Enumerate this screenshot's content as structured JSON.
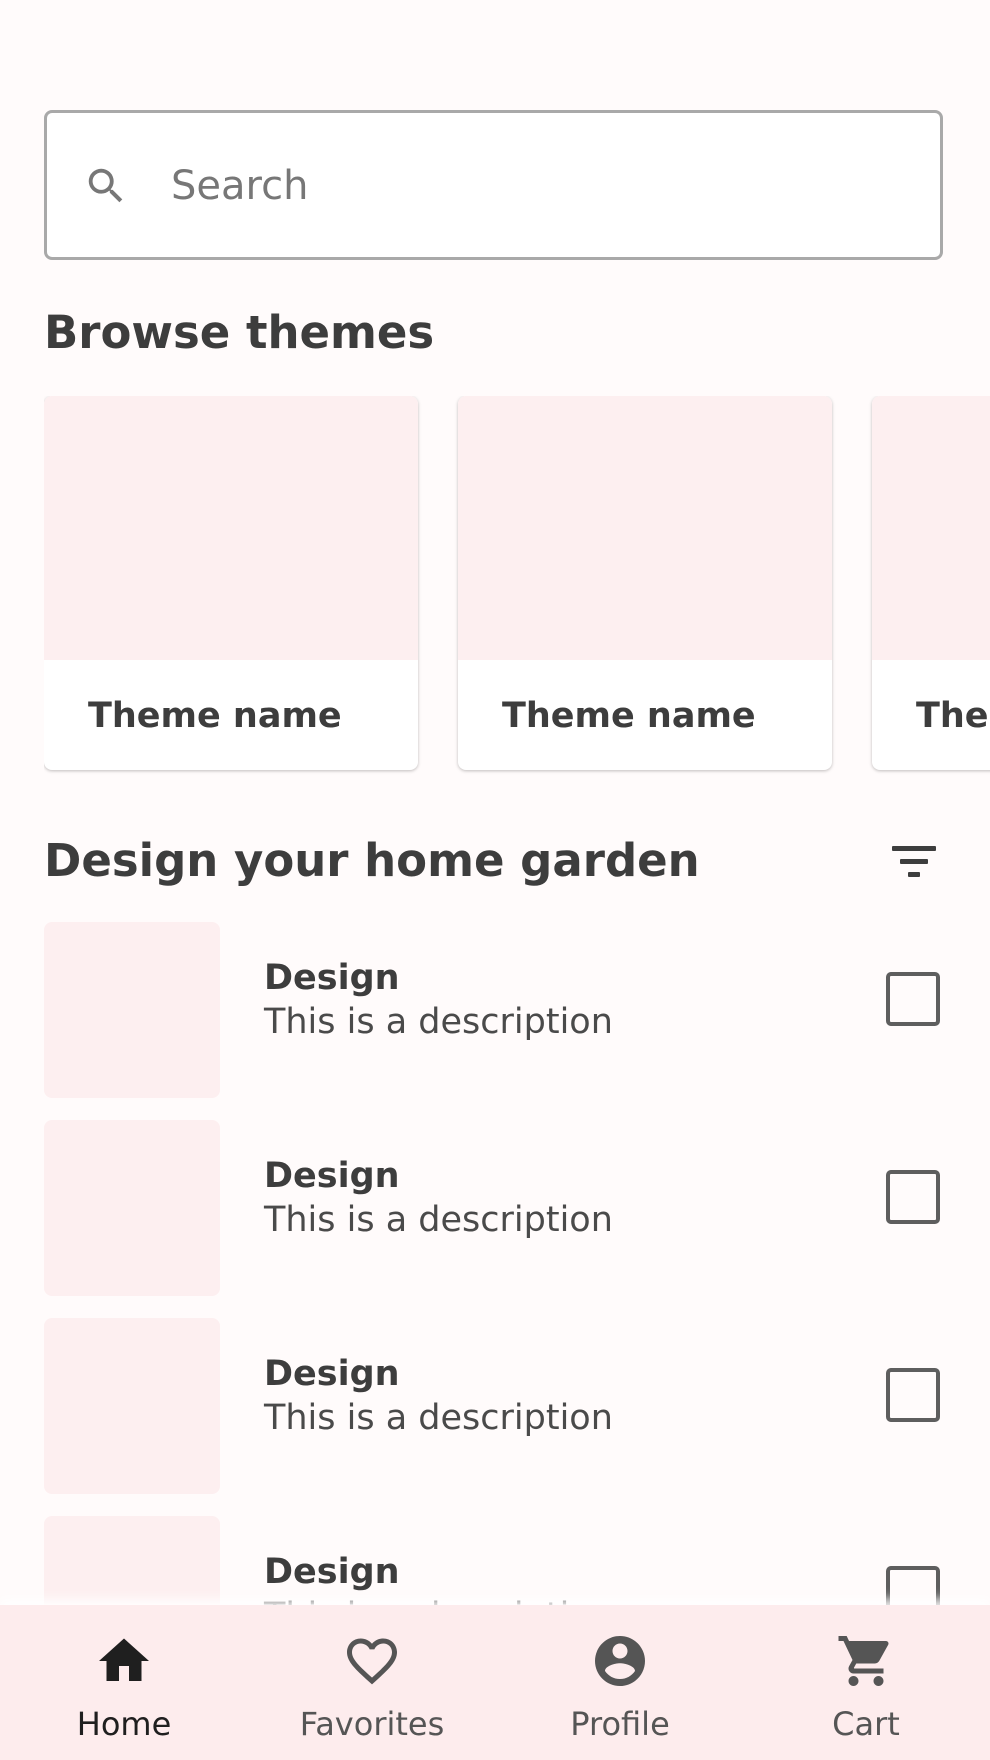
{
  "search": {
    "placeholder": "Search",
    "icon": "search-icon"
  },
  "browse": {
    "title": "Browse themes",
    "themes": [
      {
        "label": "Theme name"
      },
      {
        "label": "Theme name"
      },
      {
        "label": "Theme name"
      }
    ]
  },
  "garden": {
    "title": "Design your home garden",
    "filter_icon": "filter-icon",
    "items": [
      {
        "title": "Design",
        "description": "This is a description",
        "checked": false
      },
      {
        "title": "Design",
        "description": "This is a description",
        "checked": false
      },
      {
        "title": "Design",
        "description": "This is a description",
        "checked": false
      },
      {
        "title": "Design",
        "description": "This is a description",
        "checked": false
      }
    ]
  },
  "nav": {
    "items": [
      {
        "label": "Home",
        "icon": "home-icon",
        "active": true
      },
      {
        "label": "Favorites",
        "icon": "heart-icon",
        "active": false
      },
      {
        "label": "Profile",
        "icon": "account-circle-icon",
        "active": false
      },
      {
        "label": "Cart",
        "icon": "cart-icon",
        "active": false
      }
    ]
  },
  "colors": {
    "accent_surface": "#fdeff0",
    "nav_background": "#fdeced",
    "text_primary": "#3d3d3d"
  }
}
